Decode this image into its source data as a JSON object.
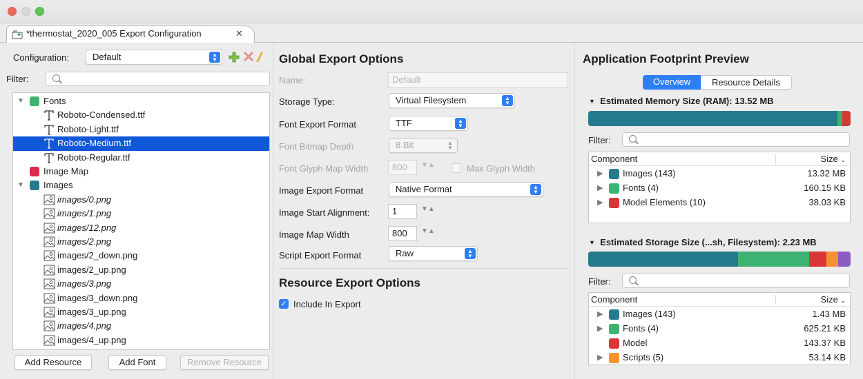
{
  "editor": {
    "tab_title": "*thermostat_2020_005 Export Configuration",
    "close_glyph": "✕",
    "tab_icon": "export-config-icon"
  },
  "left": {
    "config_label": "Configuration:",
    "config_value": "Default",
    "filter_label": "Filter:",
    "filter_placeholder": "",
    "tree": [
      {
        "label": "Fonts",
        "level": 0,
        "expanded": true,
        "icon": "folder-square",
        "color": "#3cb371",
        "italic": false,
        "selected": false
      },
      {
        "label": "Roboto-Condensed.ttf",
        "level": 1,
        "icon": "font-icon",
        "italic": false,
        "selected": false
      },
      {
        "label": "Roboto-Light.ttf",
        "level": 1,
        "icon": "font-icon",
        "italic": false,
        "selected": false
      },
      {
        "label": "Roboto-Medium.ttf",
        "level": 1,
        "icon": "font-icon",
        "italic": false,
        "selected": true
      },
      {
        "label": "Roboto-Regular.ttf",
        "level": 1,
        "icon": "font-icon",
        "italic": false,
        "selected": false
      },
      {
        "label": "Image Map",
        "level": 0,
        "expanded": null,
        "icon": "folder-square",
        "color": "#e0284a",
        "italic": false,
        "selected": false
      },
      {
        "label": "Images",
        "level": 0,
        "expanded": true,
        "icon": "folder-square",
        "color": "#267a8e",
        "italic": false,
        "selected": false
      },
      {
        "label": "images/0.png",
        "level": 1,
        "icon": "image-icon",
        "italic": true,
        "selected": false
      },
      {
        "label": "images/1.png",
        "level": 1,
        "icon": "image-icon",
        "italic": true,
        "selected": false
      },
      {
        "label": "images/12.png",
        "level": 1,
        "icon": "image-icon",
        "italic": true,
        "selected": false
      },
      {
        "label": "images/2.png",
        "level": 1,
        "icon": "image-icon",
        "italic": true,
        "selected": false
      },
      {
        "label": "images/2_down.png",
        "level": 1,
        "icon": "image-icon",
        "italic": false,
        "selected": false
      },
      {
        "label": "images/2_up.png",
        "level": 1,
        "icon": "image-icon",
        "italic": false,
        "selected": false
      },
      {
        "label": "images/3.png",
        "level": 1,
        "icon": "image-icon",
        "italic": true,
        "selected": false
      },
      {
        "label": "images/3_down.png",
        "level": 1,
        "icon": "image-icon",
        "italic": false,
        "selected": false
      },
      {
        "label": "images/3_up.png",
        "level": 1,
        "icon": "image-icon",
        "italic": false,
        "selected": false
      },
      {
        "label": "images/4.png",
        "level": 1,
        "icon": "image-icon",
        "italic": true,
        "selected": false
      },
      {
        "label": "images/4_up.png",
        "level": 1,
        "icon": "image-icon",
        "italic": false,
        "selected": false
      }
    ],
    "buttons": {
      "add_resource": "Add Resource",
      "add_font": "Add Font",
      "remove_resource": "Remove Resource"
    }
  },
  "middle": {
    "global_heading": "Global Export Options",
    "name_label": "Name:",
    "name_placeholder": "Default",
    "storage_label": "Storage Type:",
    "storage_value": "Virtual Filesystem",
    "font_format_label": "Font Export Format",
    "font_format_value": "TTF",
    "bitmap_depth_label": "Font Bitmap Depth",
    "bitmap_depth_value": "8 Bit",
    "glyph_width_label": "Font Glyph Map Width",
    "glyph_width_value": "800",
    "max_glyph_label": "Max Glyph Width",
    "image_format_label": "Image Export Format",
    "image_format_value": "Native Format",
    "image_align_label": "Image Start Alignment:",
    "image_align_value": "1",
    "image_map_width_label": "Image Map Width",
    "image_map_width_value": "800",
    "script_format_label": "Script Export Format",
    "script_format_value": "Raw",
    "resource_heading": "Resource Export Options",
    "include_label": "Include In Export",
    "include_checked": true
  },
  "right": {
    "heading": "Application Footprint Preview",
    "tabs": [
      "Overview",
      "Resource Details"
    ],
    "active_tab": "Overview",
    "memory": {
      "title": "Estimated Memory Size (RAM): 13.52 MB",
      "bar": [
        {
          "color": "#267a8e",
          "fraction": 0.949
        },
        {
          "color": "#3cb371",
          "fraction": 0.02
        },
        {
          "color": "#d93636",
          "fraction": 0.031
        }
      ],
      "filter_label": "Filter:",
      "col_component": "Component",
      "col_size": "Size",
      "rows": [
        {
          "name": "Images (143)",
          "size": "13.32 MB",
          "color": "#267a8e",
          "expandable": true
        },
        {
          "name": "Fonts (4)",
          "size": "160.15 KB",
          "color": "#3cb371",
          "expandable": true
        },
        {
          "name": "Model Elements (10)",
          "size": "38.03 KB",
          "color": "#d93636",
          "expandable": true
        }
      ]
    },
    "storage": {
      "title": "Estimated Storage Size (...sh, Filesystem): 2.23 MB",
      "bar": [
        {
          "color": "#267a8e",
          "fraction": 0.571
        },
        {
          "color": "#3cb371",
          "fraction": 0.272
        },
        {
          "color": "#d93636",
          "fraction": 0.064
        },
        {
          "color": "#f5922f",
          "fraction": 0.045
        },
        {
          "color": "#8a5cc0",
          "fraction": 0.048
        }
      ],
      "filter_label": "Filter:",
      "col_component": "Component",
      "col_size": "Size",
      "rows": [
        {
          "name": "Images (143)",
          "size": "1.43 MB",
          "color": "#267a8e",
          "expandable": true
        },
        {
          "name": "Fonts (4)",
          "size": "625.21 KB",
          "color": "#3cb371",
          "expandable": true
        },
        {
          "name": "Model",
          "size": "143.37 KB",
          "color": "#d93636",
          "expandable": false
        },
        {
          "name": "Scripts (5)",
          "size": "53.14 KB",
          "color": "#f5922f",
          "expandable": true
        }
      ]
    }
  }
}
